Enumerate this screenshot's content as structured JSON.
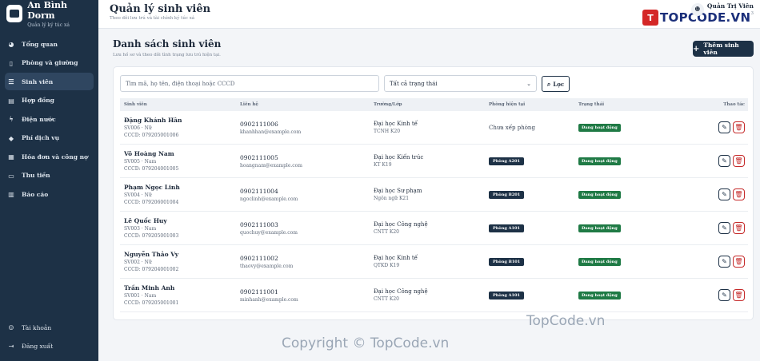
{
  "brand": {
    "title": "An Bình Dorm",
    "subtitle": "Quản lý ký túc xá"
  },
  "sidebar": {
    "items": [
      {
        "label": "Tổng quan",
        "icon": "pie-chart-icon"
      },
      {
        "label": "Phòng và giường",
        "icon": "door-icon"
      },
      {
        "label": "Sinh viên",
        "icon": "users-icon",
        "active": true
      },
      {
        "label": "Hợp đồng",
        "icon": "contract-icon"
      },
      {
        "label": "Điện nước",
        "icon": "bolt-icon"
      },
      {
        "label": "Phí dịch vụ",
        "icon": "tag-icon"
      },
      {
        "label": "Hóa đơn và công nợ",
        "icon": "invoice-icon"
      },
      {
        "label": "Thu tiền",
        "icon": "cash-icon"
      },
      {
        "label": "Báo cáo",
        "icon": "report-icon"
      }
    ],
    "bottom": [
      {
        "label": "Tài khoản",
        "icon": "account-icon"
      },
      {
        "label": "Đăng xuất",
        "icon": "logout-icon"
      }
    ]
  },
  "header": {
    "title": "Quản lý sinh viên",
    "subtitle": "Theo dõi lưu trú và tài chính ký túc xá",
    "user_name": "Quản Trị Viên",
    "user_role": "3"
  },
  "watermark": {
    "logo_text": "TOPCODE.VN",
    "footer1": "TopCode.vn",
    "footer2": "Copyright © TopCode.vn"
  },
  "main": {
    "title": "Danh sách sinh viên",
    "subtitle": "Lưu hồ sơ và theo dõi tình trạng lưu trú hiện tại.",
    "add_label": "Thêm sinh viên",
    "search_placeholder": "Tìm mã, họ tên, điện thoại hoặc CCCD",
    "status_select": "Tất cả trạng thái",
    "filter_label": "Lọc"
  },
  "table": {
    "headers": [
      "Sinh viên",
      "Liên hệ",
      "Trường/Lớp",
      "Phòng hiện tại",
      "Trạng thái",
      "Thao tác"
    ],
    "rows": [
      {
        "name": "Đặng Khánh Hân",
        "meta": "SV006 · Nữ",
        "cccd": "CCCD: 079205001006",
        "phone": "0902111006",
        "email": "khanhhan@example.com",
        "school": "Đại học Kinh tế",
        "class": "TCNH K20",
        "room": "Chưa xếp phòng",
        "room_assigned": false,
        "status": "Đang hoạt động"
      },
      {
        "name": "Võ Hoàng Nam",
        "meta": "SV005 · Nam",
        "cccd": "CCCD: 079204001005",
        "phone": "0902111005",
        "email": "hoangnam@example.com",
        "school": "Đại học Kiến trúc",
        "class": "KT K19",
        "room": "Phòng A201",
        "room_assigned": true,
        "status": "Đang hoạt động"
      },
      {
        "name": "Phạm Ngọc Linh",
        "meta": "SV004 · Nữ",
        "cccd": "CCCD: 079206001004",
        "phone": "0902111004",
        "email": "ngoclinh@example.com",
        "school": "Đại học Sư phạm",
        "class": "Ngôn ngữ K21",
        "room": "Phòng B201",
        "room_assigned": true,
        "status": "Đang hoạt động"
      },
      {
        "name": "Lê Quốc Huy",
        "meta": "SV003 · Nam",
        "cccd": "CCCD: 079205001003",
        "phone": "0902111003",
        "email": "quochuy@example.com",
        "school": "Đại học Công nghệ",
        "class": "CNTT K20",
        "room": "Phòng A101",
        "room_assigned": true,
        "status": "Đang hoạt động"
      },
      {
        "name": "Nguyễn Thảo Vy",
        "meta": "SV002 · Nữ",
        "cccd": "CCCD: 079204001002",
        "phone": "0902111002",
        "email": "thaovy@example.com",
        "school": "Đại học Kinh tế",
        "class": "QTKD K19",
        "room": "Phòng B101",
        "room_assigned": true,
        "status": "Đang hoạt động"
      },
      {
        "name": "Trần Minh Anh",
        "meta": "SV001 · Nam",
        "cccd": "CCCD: 079205001001",
        "phone": "0902111001",
        "email": "minhanh@example.com",
        "school": "Đại học Công nghệ",
        "class": "CNTT K20",
        "room": "Phòng A101",
        "room_assigned": true,
        "status": "Đang hoạt động"
      }
    ]
  },
  "colors": {
    "sidebar": "#1d3146",
    "accent": "#1d3146",
    "success": "#1f7a45",
    "danger": "#c52a2a",
    "brand_red": "#d42727"
  }
}
